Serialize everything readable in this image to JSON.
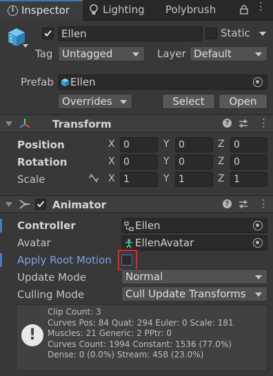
{
  "tabs": [
    {
      "label": "Inspector",
      "icon": "info-icon",
      "active": true
    },
    {
      "label": "Lighting",
      "icon": "lightbulb-icon",
      "active": false
    },
    {
      "label": "Polybrush",
      "icon": "",
      "active": false
    }
  ],
  "object": {
    "name": "Ellen",
    "active": true,
    "static_label": "Static",
    "static_checked": false,
    "tag_label": "Tag",
    "tag_value": "Untagged",
    "layer_label": "Layer",
    "layer_value": "Default",
    "prefab_label": "Prefab",
    "prefab_value": "Ellen",
    "overrides_label": "Overrides",
    "select_label": "Select",
    "open_label": "Open"
  },
  "transform": {
    "title": "Transform",
    "position_label": "Position",
    "rotation_label": "Rotation",
    "scale_label": "Scale",
    "axes": [
      "X",
      "Y",
      "Z"
    ],
    "position": [
      "0",
      "0",
      "0"
    ],
    "rotation": [
      "0",
      "0",
      "0"
    ],
    "scale": [
      "1",
      "1",
      "1"
    ]
  },
  "animator": {
    "title": "Animator",
    "enabled": true,
    "controller_label": "Controller",
    "controller_value": "Ellen",
    "avatar_label": "Avatar",
    "avatar_value": "EllenAvatar",
    "apply_root_motion_label": "Apply Root Motion",
    "apply_root_motion_checked": false,
    "update_mode_label": "Update Mode",
    "update_mode_value": "Normal",
    "culling_mode_label": "Culling Mode",
    "culling_mode_value": "Cull Update Transforms",
    "info_lines": [
      "Clip Count: 3",
      "Curves Pos: 84 Quat: 294 Euler: 0 Scale: 181",
      "Muscles: 21 Generic: 2 PPtr: 0",
      "Curves Count: 1994 Constant: 1536 (77.0%)",
      "Dense: 0 (0.0%) Stream: 458 (23.0%)"
    ]
  },
  "colors": {
    "accent_blue": "#4b7bbb",
    "highlight_red": "#e0242b",
    "apply_root_motion_text": "#7ba5e6"
  }
}
